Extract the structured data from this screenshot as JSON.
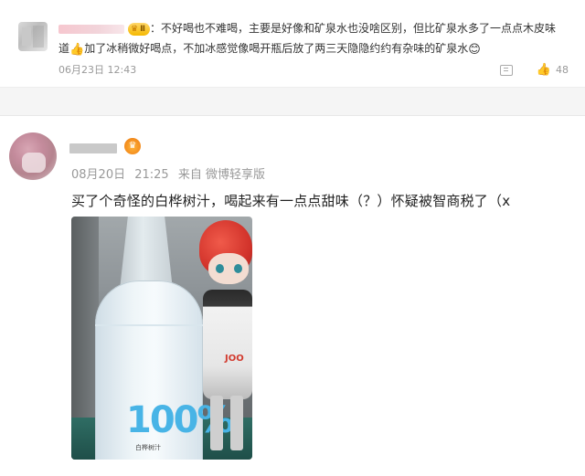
{
  "comment": {
    "badge_label": "Ⅱ",
    "text_line1": "：不好喝也不难喝，主要是好像和矿泉水也没啥区别，但比矿泉水多了一点点木皮味",
    "text_line2_a": "道",
    "text_line2_b": "加了冰稍微好喝点，不加冰感觉像喝开瓶后放了两三天隐隐约约有杂味的矿泉水",
    "date": "06月23日",
    "time": "12:43",
    "like_count": "48"
  },
  "post": {
    "date": "08月20日",
    "time": "21:25",
    "source": "来自 微博轻享版",
    "text": "买了个奇怪的白桦树汁，喝起来有一点点甜味（？）怀疑被智商税了（x"
  },
  "photo": {
    "bottle_label": "100%",
    "bottle_small": "白桦树汁",
    "figure_tag": "JOO"
  },
  "icons": {
    "comment_avatar": "avatar-icon",
    "badge": "crown-badge-icon",
    "share": "share-icon",
    "like": "thumbs-up-icon",
    "vip": "vip-crown-icon"
  },
  "colors": {
    "badge": "#f5b800",
    "vip": "#f28a1c",
    "meta_text": "#999999",
    "label_blue": "#48b4e6"
  }
}
